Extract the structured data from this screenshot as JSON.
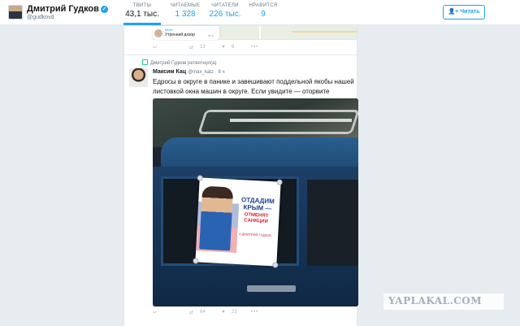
{
  "profile": {
    "name": "Дмитрий Гудков",
    "handle": "@gudkovd",
    "verified_icon": "verified-badge-icon"
  },
  "stats": [
    {
      "label": "ТВИТЫ",
      "value": "43,1 тыс."
    },
    {
      "label": "ЧИТАЕМЫЕ",
      "value": "1 328"
    },
    {
      "label": "ЧИТАТЕЛИ",
      "value": "226 тыс."
    },
    {
      "label": "НРАВИТСЯ",
      "value": "9"
    }
  ],
  "follow_button": {
    "label": "Читать",
    "icon": "add-user-icon"
  },
  "previous_tweet": {
    "quote_source": "Митя",
    "quote_text": "Утренний дозор",
    "quote_time": "08:11",
    "retweets": "13",
    "likes": "6"
  },
  "tweet": {
    "retweet_context": "Дмитрий Гудков ретвитнул(а)",
    "author_name": "Максим Кац",
    "author_handle": "@max_katz",
    "time": "8 ч",
    "text": "Едросы в округе в панике и завешивают поддельной якобы нашей листовкой окна машин в округе. Если увидите — оторвите",
    "poster": {
      "line1": "ОТДАДИМ КРЫМ —",
      "line2": "ОТМЕНЯТ САНКЦИИ",
      "line3": "# ДМИТРИЙ ГУДКОВ"
    },
    "retweets": "64",
    "likes": "23"
  },
  "watermark": "YAPLAKAL.COM",
  "colors": {
    "accent": "#1da1f2",
    "retweet_green": "#19cf86",
    "background": "#e6ecf0"
  }
}
